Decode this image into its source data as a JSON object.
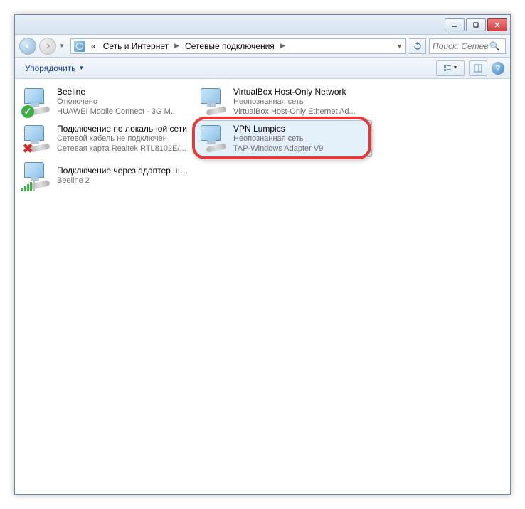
{
  "breadcrumb": {
    "root_label": "«",
    "item1": "Сеть и Интернет",
    "item2": "Сетевые подключения"
  },
  "search": {
    "placeholder": "Поиск: Сетев..."
  },
  "toolbar": {
    "organize": "Упорядочить"
  },
  "connections": [
    {
      "name": "Beeline",
      "status": "Отключено",
      "device": "HUAWEI Mobile Connect - 3G M...",
      "overlay": "ok"
    },
    {
      "name": "VirtualBox Host-Only Network",
      "status": "Неопознанная сеть",
      "device": "VirtualBox Host-Only Ethernet Ad...",
      "overlay": "none"
    },
    {
      "name": "Подключение по локальной сети",
      "status": "Сетевой кабель не подключен",
      "device": "Сетевая карта Realtek RTL8102E/...",
      "overlay": "err"
    },
    {
      "name": "VPN Lumpics",
      "status": "Неопознанная сеть",
      "device": "TAP-Windows Adapter V9",
      "overlay": "none",
      "selected": true,
      "highlighted": true
    },
    {
      "name": "Подключение через адаптер широкополосной мобильной с...",
      "status": "Beeline  2",
      "device": "",
      "overlay": "sig"
    }
  ]
}
